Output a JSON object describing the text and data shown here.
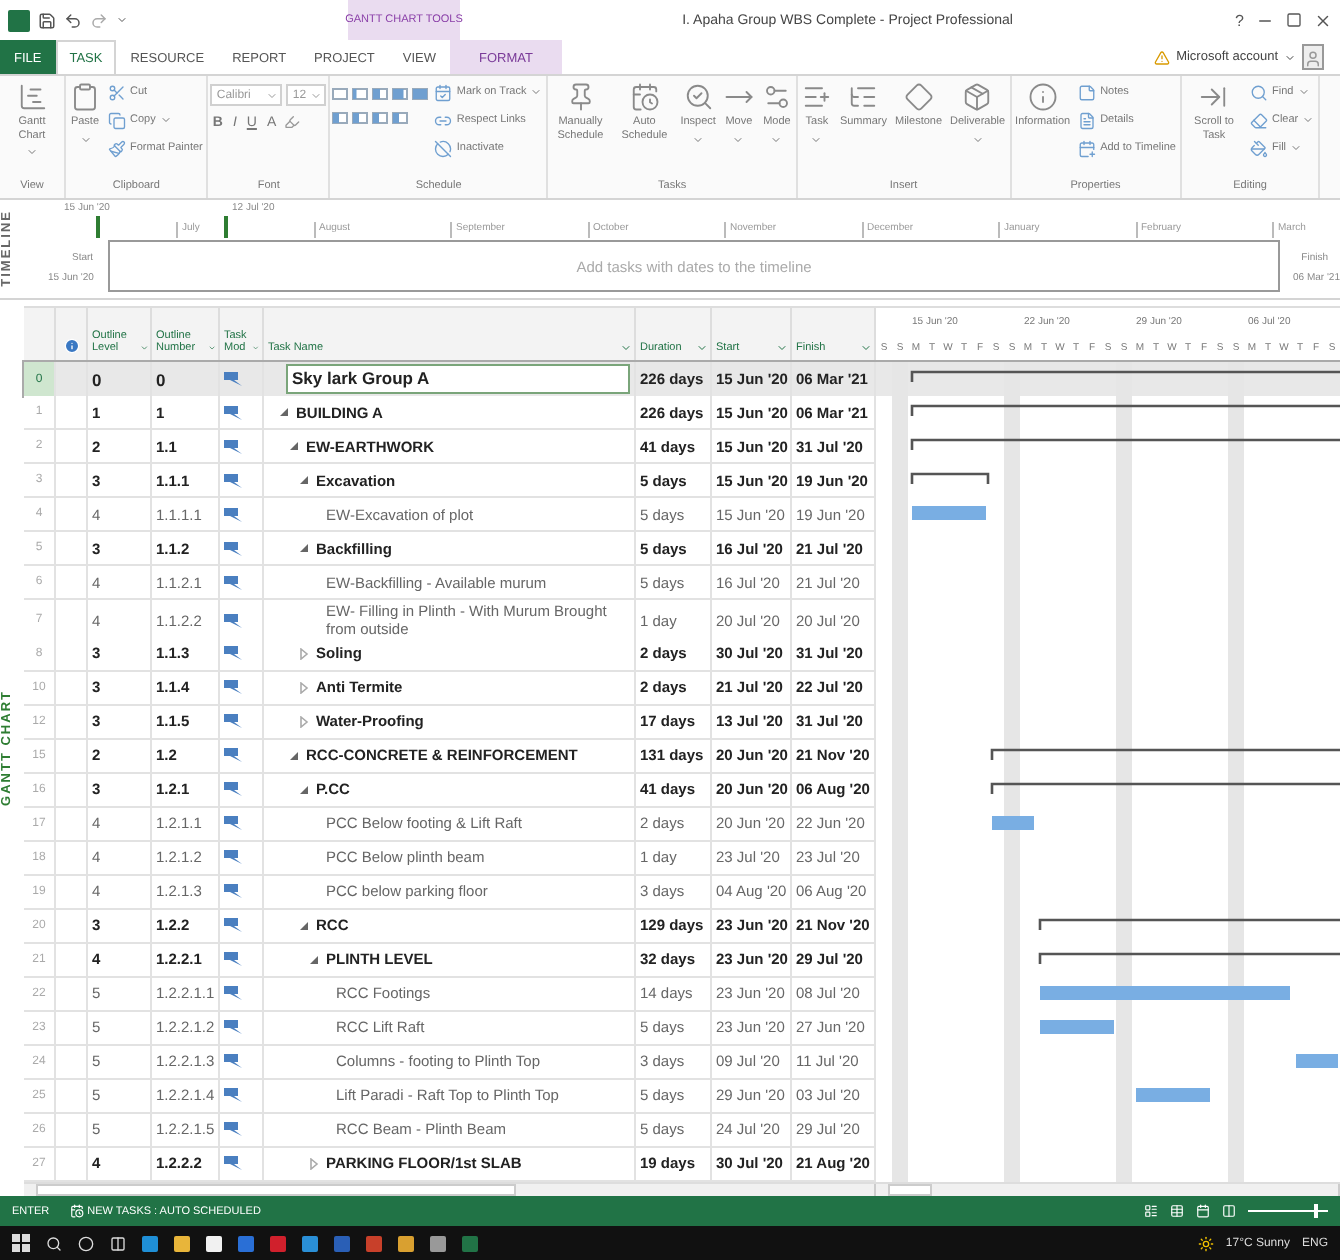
{
  "title_bar": {
    "context_label": "GANTT CHART TOOLS",
    "title": "I. Apaha Group WBS Complete - Project Professional",
    "help": "?"
  },
  "tabs": [
    {
      "label": "FILE",
      "kind": "file",
      "selected": false
    },
    {
      "label": "TASK",
      "kind": "tab",
      "selected": true
    },
    {
      "label": "RESOURCE",
      "kind": "tab",
      "selected": false
    },
    {
      "label": "REPORT",
      "kind": "tab",
      "selected": false
    },
    {
      "label": "PROJECT",
      "kind": "tab",
      "selected": false
    },
    {
      "label": "VIEW",
      "kind": "tab",
      "selected": false
    },
    {
      "label": "FORMAT",
      "kind": "contextual",
      "selected": false
    }
  ],
  "account": "Microsoft account",
  "ribbon": [
    {
      "label": "View",
      "items": [
        {
          "kind": "large",
          "label": "Gantt Chart",
          "dropdown": true
        }
      ]
    },
    {
      "label": "Clipboard",
      "items": [
        {
          "kind": "large",
          "label": "Paste",
          "dropdown": true
        },
        {
          "kind": "small",
          "label": "Cut",
          "dropdown": false
        },
        {
          "kind": "small",
          "label": "Copy",
          "dropdown": true
        },
        {
          "kind": "small",
          "label": "Format Painter",
          "dropdown": false
        }
      ]
    },
    {
      "label": "Font",
      "items": [
        {
          "kind": "combo",
          "value": "Calibri"
        },
        {
          "kind": "combo",
          "value": "12"
        },
        {
          "kind": "glyph",
          "label": "B"
        },
        {
          "kind": "glyph",
          "label": "I"
        },
        {
          "kind": "glyph",
          "label": "U"
        },
        {
          "kind": "glyph",
          "label": "A"
        }
      ]
    },
    {
      "label": "Schedule",
      "items": [
        {
          "kind": "icon-grid"
        },
        {
          "kind": "small",
          "label": "Mark on Track",
          "dropdown": true
        },
        {
          "kind": "small",
          "label": "Respect Links",
          "dropdown": false
        },
        {
          "kind": "small",
          "label": "Inactivate",
          "dropdown": false
        }
      ]
    },
    {
      "label": "Tasks",
      "items": [
        {
          "kind": "large",
          "label": "Manually Schedule",
          "dropdown": false
        },
        {
          "kind": "large",
          "label": "Auto Schedule",
          "dropdown": false
        },
        {
          "kind": "large",
          "label": "Inspect",
          "dropdown": true
        },
        {
          "kind": "large",
          "label": "Move",
          "dropdown": true
        },
        {
          "kind": "large",
          "label": "Mode",
          "dropdown": true
        }
      ]
    },
    {
      "label": "Insert",
      "items": [
        {
          "kind": "large",
          "label": "Task",
          "dropdown": true
        },
        {
          "kind": "large",
          "label": "Summary",
          "dropdown": false
        },
        {
          "kind": "large",
          "label": "Milestone",
          "dropdown": false
        },
        {
          "kind": "large",
          "label": "Deliverable",
          "dropdown": true
        }
      ]
    },
    {
      "label": "Properties",
      "items": [
        {
          "kind": "large",
          "label": "Information",
          "dropdown": false
        },
        {
          "kind": "small",
          "label": "Notes",
          "dropdown": false
        },
        {
          "kind": "small",
          "label": "Details",
          "dropdown": false
        },
        {
          "kind": "small",
          "label": "Add to Timeline",
          "dropdown": false
        }
      ]
    },
    {
      "label": "Editing",
      "items": [
        {
          "kind": "large",
          "label": "Scroll to Task",
          "dropdown": false
        },
        {
          "kind": "small",
          "label": "Find",
          "dropdown": true
        },
        {
          "kind": "small",
          "label": "Clear",
          "dropdown": true
        },
        {
          "kind": "small",
          "label": "Fill",
          "dropdown": true
        }
      ]
    }
  ],
  "timeline": {
    "label": "TIMELINE",
    "range_start": "15 Jun '20",
    "range_end": "12 Jul '20",
    "months": [
      "July",
      "August",
      "September",
      "October",
      "November",
      "December",
      "January",
      "February",
      "March"
    ],
    "start_label": "Start",
    "start_value": "15 Jun '20",
    "finish_label": "Finish",
    "finish_value": "06 Mar '21",
    "placeholder": "Add tasks with dates to the timeline"
  },
  "table": {
    "side_label": "GANTT CHART",
    "columns": [
      "Outline Level",
      "Outline Number",
      "Task Mod",
      "Task Name",
      "Duration",
      "Start",
      "Finish"
    ],
    "rows": [
      {
        "id": "0",
        "level": "0",
        "number": "0",
        "name": "Sky lark Group A",
        "duration": "226 days",
        "start": "15 Jun '20",
        "finish": "06 Mar '21",
        "kind": "summary",
        "selected": true,
        "children": [
          {
            "id": "1",
            "level": "1",
            "number": "1",
            "name": "BUILDING A",
            "duration": "226 days",
            "start": "15 Jun '20",
            "finish": "06 Mar '21",
            "kind": "summary",
            "expanded": true,
            "selected": false,
            "children": [
              {
                "id": "2",
                "level": "2",
                "number": "1.1",
                "name": "EW-EARTHWORK",
                "duration": "41 days",
                "start": "15 Jun '20",
                "finish": "31 Jul '20",
                "kind": "summary",
                "expanded": true,
                "selected": false,
                "children": [
                  {
                    "id": "3",
                    "level": "3",
                    "number": "1.1.1",
                    "name": "Excavation",
                    "duration": "5 days",
                    "start": "15 Jun '20",
                    "finish": "19 Jun '20",
                    "kind": "summary",
                    "expanded": true,
                    "selected": false,
                    "children": [
                      {
                        "id": "4",
                        "level": "4",
                        "number": "1.1.1.1",
                        "name": "EW-Excavation of plot",
                        "duration": "5 days",
                        "start": "15 Jun '20",
                        "finish": "19 Jun '20",
                        "kind": "task",
                        "selected": false
                      }
                    ]
                  },
                  {
                    "id": "5",
                    "level": "3",
                    "number": "1.1.2",
                    "name": "Backfilling",
                    "duration": "5 days",
                    "start": "16 Jul '20",
                    "finish": "21 Jul '20",
                    "kind": "summary",
                    "expanded": true,
                    "selected": false,
                    "children": [
                      {
                        "id": "6",
                        "level": "4",
                        "number": "1.1.2.1",
                        "name": "EW-Backfilling - Available murum",
                        "duration": "5 days",
                        "start": "16 Jul '20",
                        "finish": "21 Jul '20",
                        "kind": "task",
                        "selected": false
                      },
                      {
                        "id": "7",
                        "level": "4",
                        "number": "1.1.2.2",
                        "name": "EW- Filling in Plinth - With Murum Brought from outside",
                        "duration": "1 day",
                        "start": "20 Jul '20",
                        "finish": "20 Jul '20",
                        "kind": "task",
                        "selected": false
                      }
                    ]
                  },
                  {
                    "id": "8",
                    "level": "3",
                    "number": "1.1.3",
                    "name": "Soling",
                    "duration": "2 days",
                    "start": "30 Jul '20",
                    "finish": "31 Jul '20",
                    "kind": "summary",
                    "expanded": false,
                    "selected": false
                  },
                  {
                    "id": "10",
                    "level": "3",
                    "number": "1.1.4",
                    "name": "Anti Termite",
                    "duration": "2 days",
                    "start": "21 Jul '20",
                    "finish": "22 Jul '20",
                    "kind": "summary",
                    "expanded": false,
                    "selected": false
                  },
                  {
                    "id": "12",
                    "level": "3",
                    "number": "1.1.5",
                    "name": "Water-Proofing",
                    "duration": "17 days",
                    "start": "13 Jul '20",
                    "finish": "31 Jul '20",
                    "kind": "summary",
                    "expanded": false,
                    "selected": false
                  }
                ]
              },
              {
                "id": "15",
                "level": "2",
                "number": "1.2",
                "name": "RCC-CONCRETE & REINFORCEMENT",
                "duration": "131 days",
                "start": "20 Jun '20",
                "finish": "21 Nov '20",
                "kind": "summary",
                "expanded": true,
                "selected": false,
                "children": [
                  {
                    "id": "16",
                    "level": "3",
                    "number": "1.2.1",
                    "name": "P.CC",
                    "duration": "41 days",
                    "start": "20 Jun '20",
                    "finish": "06 Aug '20",
                    "kind": "summary",
                    "expanded": true,
                    "selected": false,
                    "children": [
                      {
                        "id": "17",
                        "level": "4",
                        "number": "1.2.1.1",
                        "name": "PCC Below footing & Lift Raft",
                        "duration": "2 days",
                        "start": "20 Jun '20",
                        "finish": "22 Jun '20",
                        "kind": "task",
                        "selected": false
                      },
                      {
                        "id": "18",
                        "level": "4",
                        "number": "1.2.1.2",
                        "name": "PCC Below plinth beam",
                        "duration": "1 day",
                        "start": "23 Jul '20",
                        "finish": "23 Jul '20",
                        "kind": "task",
                        "selected": false
                      },
                      {
                        "id": "19",
                        "level": "4",
                        "number": "1.2.1.3",
                        "name": "PCC below parking floor",
                        "duration": "3 days",
                        "start": "04 Aug '20",
                        "finish": "06 Aug '20",
                        "kind": "task",
                        "selected": false
                      }
                    ]
                  },
                  {
                    "id": "20",
                    "level": "3",
                    "number": "1.2.2",
                    "name": "RCC",
                    "duration": "129 days",
                    "start": "23 Jun '20",
                    "finish": "21 Nov '20",
                    "kind": "summary",
                    "expanded": true,
                    "selected": false,
                    "children": [
                      {
                        "id": "21",
                        "level": "4",
                        "number": "1.2.2.1",
                        "name": "PLINTH LEVEL",
                        "duration": "32 days",
                        "start": "23 Jun '20",
                        "finish": "29 Jul '20",
                        "kind": "summary",
                        "expanded": true,
                        "selected": false,
                        "children": [
                          {
                            "id": "22",
                            "level": "5",
                            "number": "1.2.2.1.1",
                            "name": "RCC Footings",
                            "duration": "14 days",
                            "start": "23 Jun '20",
                            "finish": "08 Jul '20",
                            "kind": "task",
                            "selected": false
                          },
                          {
                            "id": "23",
                            "level": "5",
                            "number": "1.2.2.1.2",
                            "name": "RCC Lift Raft",
                            "duration": "5 days",
                            "start": "23 Jun '20",
                            "finish": "27 Jun '20",
                            "kind": "task",
                            "selected": false
                          },
                          {
                            "id": "24",
                            "level": "5",
                            "number": "1.2.2.1.3",
                            "name": "Columns - footing to Plinth Top",
                            "duration": "3 days",
                            "start": "09 Jul '20",
                            "finish": "11 Jul '20",
                            "kind": "task",
                            "selected": false
                          },
                          {
                            "id": "25",
                            "level": "5",
                            "number": "1.2.2.1.4",
                            "name": "Lift Paradi - Raft Top to Plinth Top",
                            "duration": "5 days",
                            "start": "29 Jun '20",
                            "finish": "03 Jul '20",
                            "kind": "task",
                            "selected": false
                          },
                          {
                            "id": "26",
                            "level": "5",
                            "number": "1.2.2.1.5",
                            "name": "RCC Beam - Plinth Beam",
                            "duration": "5 days",
                            "start": "24 Jul '20",
                            "finish": "29 Jul '20",
                            "kind": "task",
                            "selected": false
                          }
                        ]
                      },
                      {
                        "id": "27",
                        "level": "4",
                        "number": "1.2.2.2",
                        "name": "PARKING FLOOR/1st SLAB",
                        "duration": "19 days",
                        "start": "30 Jul '20",
                        "finish": "21 Aug '20",
                        "kind": "summary",
                        "expanded": false,
                        "selected": false
                      }
                    ]
                  }
                ]
              }
            ]
          }
        ]
      }
    ]
  },
  "gantt": {
    "weeks": [
      "15 Jun '20",
      "22 Jun '20",
      "29 Jun '20",
      "06 Jul '20"
    ],
    "days": [
      "S",
      "S",
      "M",
      "T",
      "W",
      "T",
      "F",
      "S",
      "S",
      "M",
      "T",
      "W",
      "T",
      "F",
      "S",
      "S",
      "M",
      "T",
      "W",
      "T",
      "F",
      "S",
      "S",
      "M",
      "T",
      "W",
      "T",
      "F",
      "S"
    ]
  },
  "status_bar": {
    "mode": "ENTER",
    "new_tasks": "NEW TASKS : AUTO SCHEDULED",
    "zoom": {
      "level": 0.85
    }
  },
  "taskbar": {
    "weather": "17°C Sunny",
    "language": "ENG"
  }
}
